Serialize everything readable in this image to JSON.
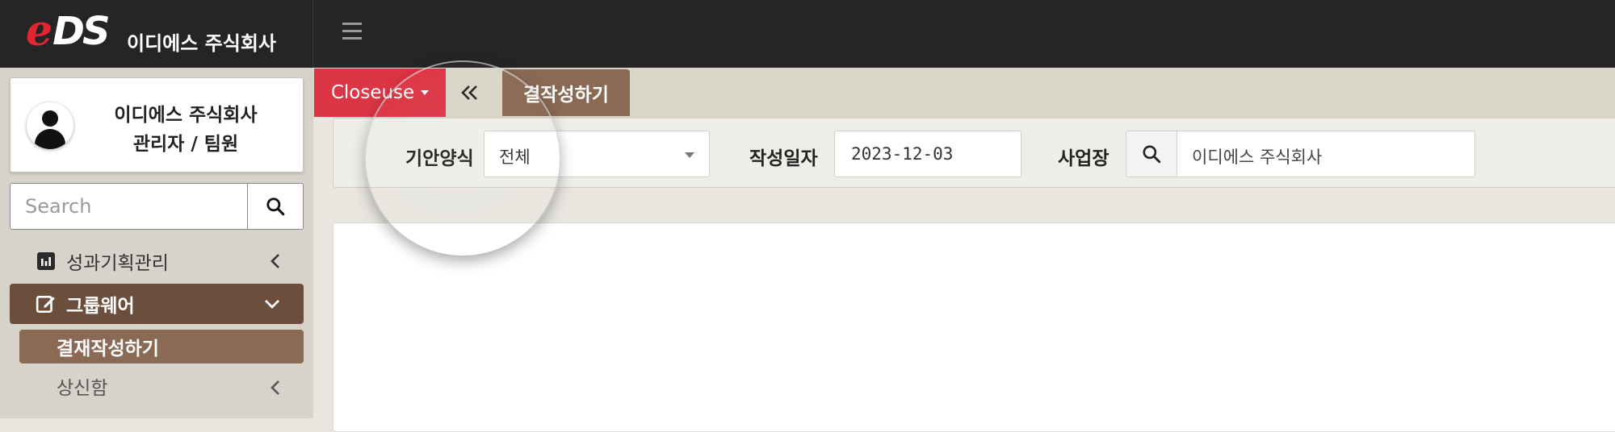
{
  "brand": {
    "logo_e": "e",
    "logo_ds": "DS",
    "company_name": "이디에스 주식회사",
    "logo_colors": {
      "e": "#e02630",
      "ds": "#ffffff"
    }
  },
  "header": {
    "menu_icon": "hamburger-icon"
  },
  "profile": {
    "company": "이디에스 주식회사",
    "user_role": "관리자 / 팀원",
    "avatar_icon": "user-icon"
  },
  "sidebar": {
    "search": {
      "placeholder": "Search",
      "icon": "search-icon"
    },
    "items": [
      {
        "label": "성과기획관리",
        "icon": "chart-icon",
        "state": "collapsed"
      },
      {
        "label": "그룹웨어",
        "icon": "edit-icon",
        "state": "expanded",
        "active": true
      }
    ],
    "sub_items": [
      {
        "label": "결재작성하기",
        "active": true
      },
      {
        "label": "상신함",
        "state": "collapsed"
      }
    ]
  },
  "tabs": {
    "close_label": "Closeuse",
    "back_icon": "double-chevron-left-icon",
    "active_tab": "결작성하기"
  },
  "filters": {
    "form_type_label": "기안양식",
    "form_type_value": "전체",
    "date_label": "작성일자",
    "date_value": "2023-12-03",
    "site_label": "사업장",
    "site_value": "이디에스 주식회사",
    "site_search_icon": "search-icon"
  },
  "colors": {
    "topbar": "#252525",
    "sidebar_bg": "#d7d3cb",
    "active_brown": "#6b4f3c",
    "sub_active_brown": "#8a6a55",
    "close_red": "#dc3545"
  }
}
